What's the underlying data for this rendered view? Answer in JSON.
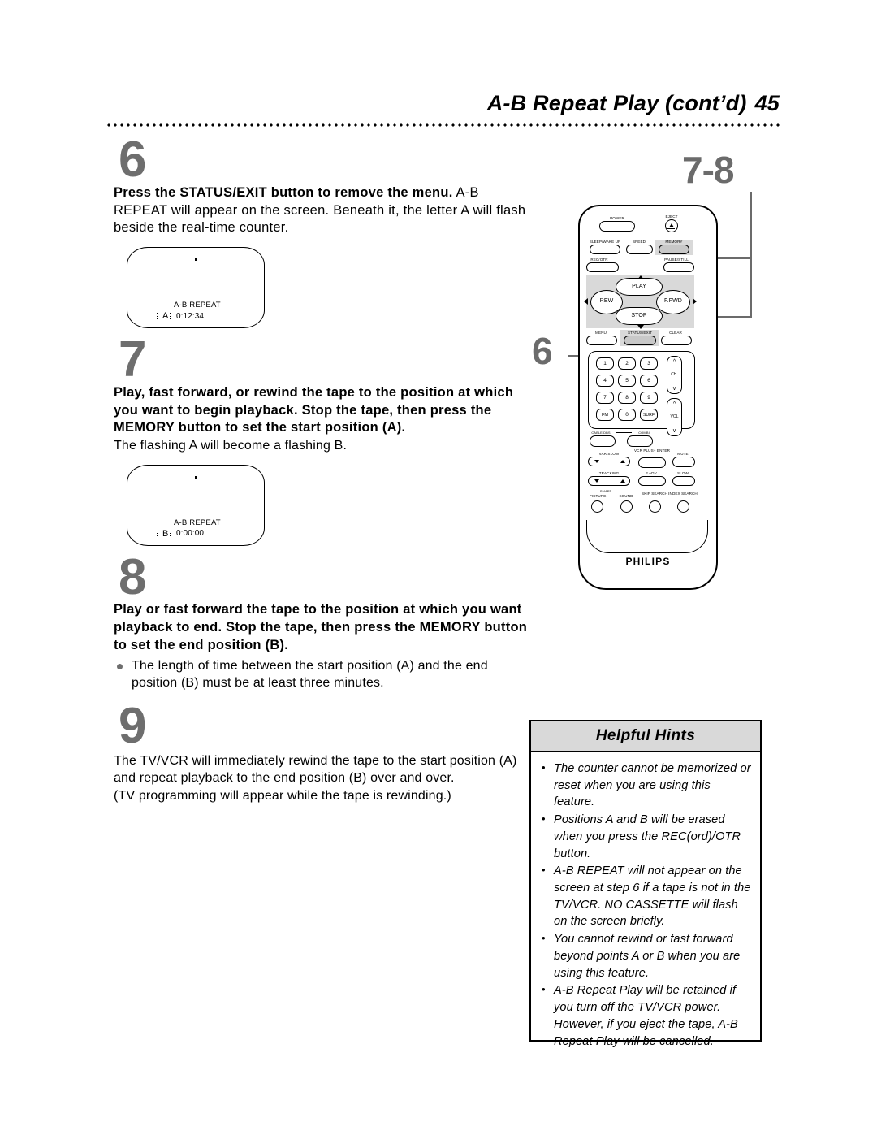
{
  "header": {
    "title": "A-B Repeat Play (cont’d)",
    "page_number": "45"
  },
  "steps": [
    {
      "number": "6",
      "bold": "Press the STATUS/EXIT button to remove the menu.",
      "rest": " A-B REPEAT will appear on the screen. Beneath it, the letter A will flash beside the real-time counter.",
      "screen": {
        "title": "A-B REPEAT",
        "letter": "A",
        "counter": "0:12:34"
      }
    },
    {
      "number": "7",
      "bold": "Play, fast forward, or rewind the tape to the position at which you want to begin playback.  Stop the tape, then press the MEMORY button to set the start position (A).",
      "body": "The flashing A will become a flashing B.",
      "screen": {
        "title": "A-B REPEAT",
        "letter": "B",
        "counter": "0:00:00"
      }
    },
    {
      "number": "8",
      "bold": "Play or fast forward the tape to the position at which you want playback to end.  Stop the tape, then press the MEMORY button to set the end position (B).",
      "bullet": "The length of time between the start position (A) and the end position (B) must be at least three minutes."
    },
    {
      "number": "9",
      "body": "The TV/VCR will immediately rewind the tape to the start position (A) and repeat playback to the end position (B) over and over.",
      "body2": "(TV programming will appear while the tape is rewinding.)"
    }
  ],
  "callouts": {
    "memory_steps": "7-8",
    "status_exit_step": "6"
  },
  "remote": {
    "brand": "PHILIPS",
    "top_buttons": [
      "POWER",
      "EJECT"
    ],
    "row2": [
      "SLEEP/WAKE UP",
      "SPEED",
      "MEMORY"
    ],
    "row3": [
      "REC/OTR",
      "PAUSE/STILL"
    ],
    "transport": [
      "PLAY",
      "REW",
      "F.FWD",
      "STOP"
    ],
    "row5": [
      "MENU",
      "STATUS/EXIT",
      "CLEAR"
    ],
    "keypad": [
      "1",
      "2",
      "3",
      "4",
      "5",
      "6",
      "7",
      "8",
      "9",
      "FM",
      "0",
      "SURF"
    ],
    "rockers": [
      "CH.",
      "VOL"
    ],
    "source_row": [
      "CABLE/DBS",
      "COMBI"
    ],
    "row_var": [
      "VAR SLOW",
      "VCR PLUS+ ENTER",
      "MUTE"
    ],
    "row_track": [
      "TRACKING",
      "F.ADV",
      "SLOW"
    ],
    "smart_label": "SMART",
    "bottom_row": [
      "PICTURE",
      "SOUND",
      "SKIP SEARCH",
      "INDEX SEARCH"
    ]
  },
  "hints": {
    "title": "Helpful Hints",
    "items": [
      "The counter cannot be memorized or reset when you are using this feature.",
      "Positions A and B will be erased when you press the REC(ord)/OTR button.",
      "A-B REPEAT will not appear on the screen at step 6 if a tape is not in the TV/VCR.  NO CASSETTE will flash on the screen briefly.",
      "You cannot rewind or fast forward beyond points A or B when you are using this feature.",
      "A-B Repeat Play will be retained if you turn off the TV/VCR power.  However, if you eject the tape, A-B Repeat Play will be cancelled."
    ]
  }
}
